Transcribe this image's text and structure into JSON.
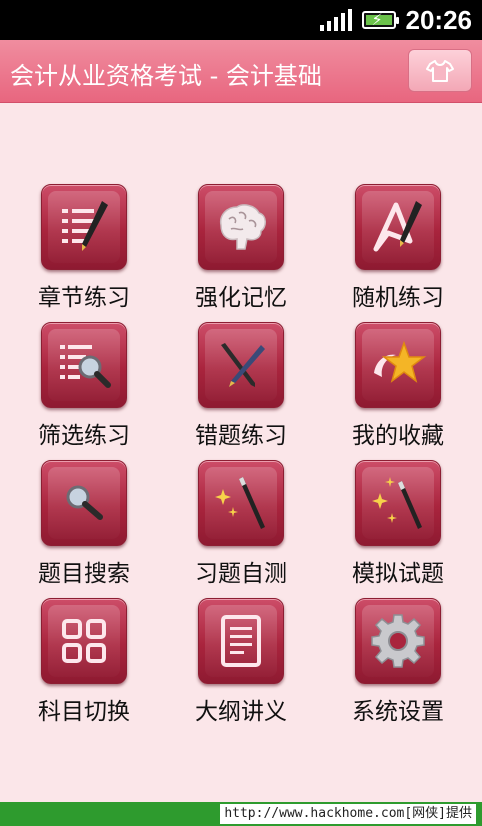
{
  "status_bar": {
    "time": "20:26",
    "signal_icon": "signal-bars-icon",
    "battery_icon": "battery-charging-icon"
  },
  "title_bar": {
    "title": "会计从业资格考试 - 会计基础",
    "skin_icon": "tshirt-icon"
  },
  "menu": [
    {
      "label": "章节练习",
      "icon": "chapter-list-pen-icon"
    },
    {
      "label": "强化记忆",
      "icon": "brain-icon"
    },
    {
      "label": "随机练习",
      "icon": "random-triangle-pen-icon"
    },
    {
      "label": "筛选练习",
      "icon": "filter-list-magnifier-icon"
    },
    {
      "label": "错题练习",
      "icon": "crossed-pens-icon"
    },
    {
      "label": "我的收藏",
      "icon": "star-icon"
    },
    {
      "label": "题目搜索",
      "icon": "magnifier-icon"
    },
    {
      "label": "习题自测",
      "icon": "magic-wand-icon"
    },
    {
      "label": "模拟试题",
      "icon": "magic-wand-sparkle-icon"
    },
    {
      "label": "科目切换",
      "icon": "grid-squares-icon"
    },
    {
      "label": "大纲讲义",
      "icon": "document-icon"
    },
    {
      "label": "系统设置",
      "icon": "gear-icon"
    }
  ],
  "footer": {
    "credit": "http://www.hackhome.com[网侠]提供"
  },
  "colors": {
    "title_bar": "#e8667f",
    "tile": "#a9243d",
    "background": "#fbe6e9",
    "footer": "#2e9b2e"
  }
}
